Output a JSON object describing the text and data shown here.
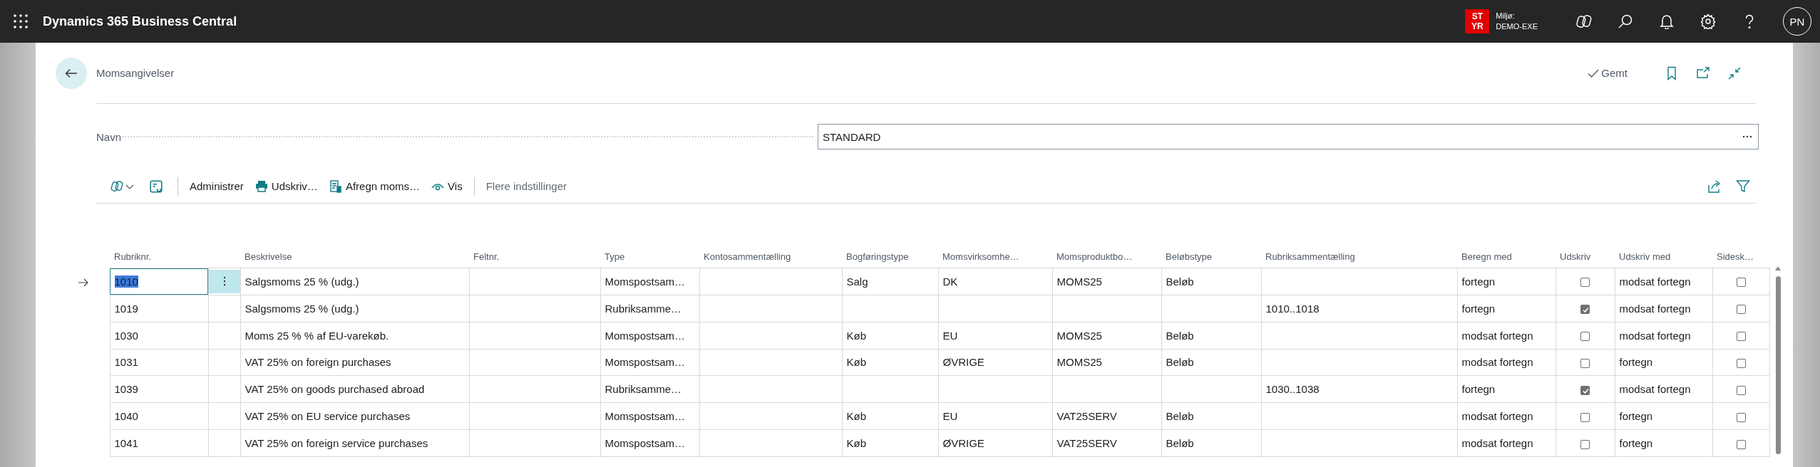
{
  "top_bar": {
    "app_title": "Dynamics 365 Business Central",
    "environment_badge": "ST YR",
    "environment_label": "Miljø:",
    "environment_name": "DEMO-EXE",
    "avatar_initials": "PN"
  },
  "page": {
    "title": "Momsangivelser",
    "save_status": "Gemt"
  },
  "name_field": {
    "label": "Navn",
    "value": "STANDARD"
  },
  "action_bar": {
    "actions": [
      {
        "label": "Administrer",
        "kind": "plain"
      },
      {
        "label": "Udskriv…",
        "kind": "print"
      },
      {
        "label": "Afregn moms…",
        "kind": "settle"
      },
      {
        "label": "Vis",
        "kind": "view"
      }
    ],
    "more_options": "Flere indstillinger"
  },
  "table": {
    "columns": [
      {
        "label": "Rubriknr.",
        "kind": "text"
      },
      {
        "label": "Beskrivelse",
        "kind": "text"
      },
      {
        "label": "Feltnr.",
        "kind": "text"
      },
      {
        "label": "Type",
        "kind": "text"
      },
      {
        "label": "Kontosammentælling",
        "kind": "text"
      },
      {
        "label": "Bogføringstype",
        "kind": "text"
      },
      {
        "label": "Momsvirksomhe…",
        "kind": "text"
      },
      {
        "label": "Momsproduktbo…",
        "kind": "text"
      },
      {
        "label": "Beløbstype",
        "kind": "text"
      },
      {
        "label": "Rubriksammentælling",
        "kind": "text"
      },
      {
        "label": "Beregn med",
        "kind": "text"
      },
      {
        "label": "Udskriv",
        "kind": "checkbox"
      },
      {
        "label": "Udskriv med",
        "kind": "text"
      },
      {
        "label": "Sidesk…",
        "kind": "checkbox"
      }
    ],
    "rows": [
      {
        "selected": true,
        "cells": [
          "1010",
          "Salgsmoms 25 % (udg.)",
          null,
          "Momspostsam…",
          null,
          "Salg",
          "DK",
          "MOMS25",
          "Beløb",
          null,
          "fortegn",
          false,
          "modsat fortegn",
          false
        ]
      },
      {
        "selected": false,
        "cells": [
          "1019",
          "Salgsmoms 25 % (udg.)",
          null,
          "Rubriksamme…",
          null,
          null,
          null,
          null,
          null,
          "1010..1018",
          "fortegn",
          true,
          "modsat fortegn",
          false
        ]
      },
      {
        "selected": false,
        "cells": [
          "1030",
          "Moms 25 % % af EU-varekøb.",
          null,
          "Momspostsam…",
          null,
          "Køb",
          "EU",
          "MOMS25",
          "Beløb",
          null,
          "modsat fortegn",
          false,
          "modsat fortegn",
          false
        ]
      },
      {
        "selected": false,
        "cells": [
          "1031",
          "VAT 25% on foreign purchases",
          null,
          "Momspostsam…",
          null,
          "Køb",
          "ØVRIGE",
          "MOMS25",
          "Beløb",
          null,
          "modsat fortegn",
          false,
          "fortegn",
          false
        ]
      },
      {
        "selected": false,
        "cells": [
          "1039",
          "VAT 25% on goods purchased abroad",
          null,
          "Rubriksamme…",
          null,
          null,
          null,
          null,
          null,
          "1030..1038",
          "fortegn",
          true,
          "modsat fortegn",
          false
        ]
      },
      {
        "selected": false,
        "cells": [
          "1040",
          "VAT 25% on EU service purchases",
          null,
          "Momspostsam…",
          null,
          "Køb",
          "EU",
          "VAT25SERV",
          "Beløb",
          null,
          "modsat fortegn",
          false,
          "fortegn",
          false
        ]
      },
      {
        "selected": false,
        "cells": [
          "1041",
          "VAT 25% on foreign service purchases",
          null,
          "Momspostsam…",
          null,
          "Køb",
          "ØVRIGE",
          "VAT25SERV",
          "Beløb",
          null,
          "modsat fortegn",
          false,
          "fortegn",
          false
        ]
      }
    ]
  }
}
